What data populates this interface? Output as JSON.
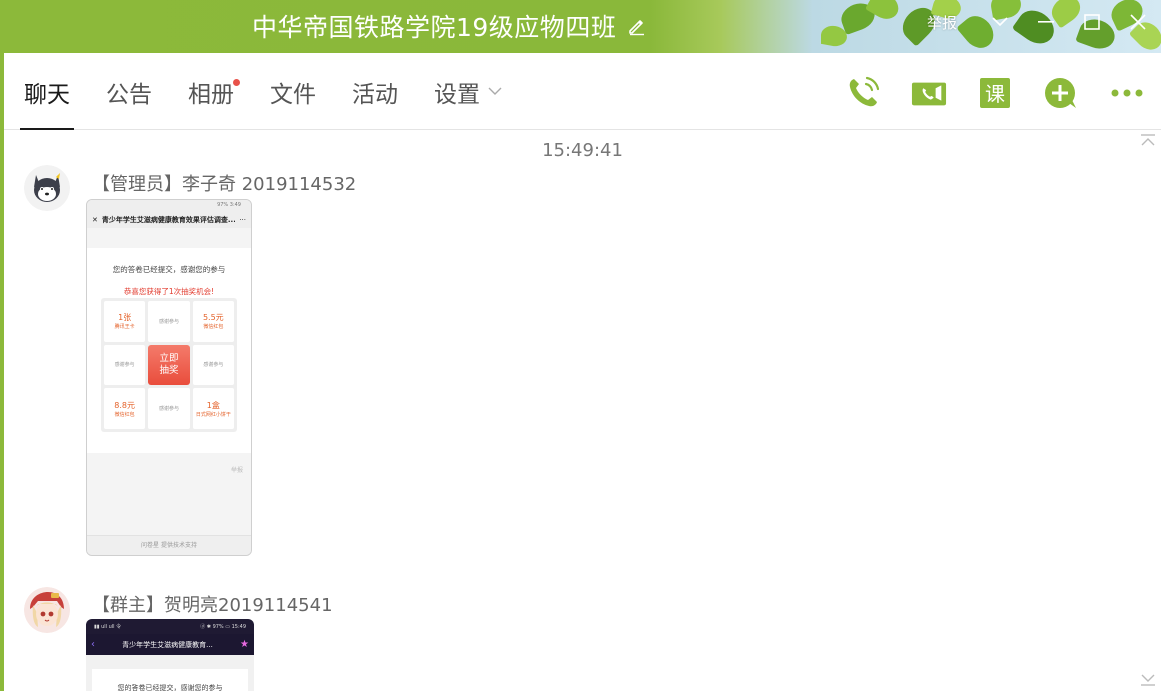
{
  "window": {
    "title": "中华帝国铁路学院19级应物四班",
    "report_label": "举报"
  },
  "tabs": [
    {
      "label": "聊天",
      "active": true
    },
    {
      "label": "公告",
      "active": false
    },
    {
      "label": "相册",
      "active": false,
      "badge": true
    },
    {
      "label": "文件",
      "active": false
    },
    {
      "label": "活动",
      "active": false
    },
    {
      "label": "设置",
      "active": false,
      "dropdown": true
    }
  ],
  "actions": {
    "course_label": "课",
    "icons": [
      "voice-call-icon",
      "video-call-icon",
      "course-icon",
      "add-icon",
      "more-icon"
    ]
  },
  "chat": {
    "timestamp": "15:49:41",
    "messages": [
      {
        "sender": "【管理员】李子奇 2019114532",
        "screenshot": {
          "status": "97% 3:49",
          "title": "青少年学生艾滋病健康教育效果评估调查...",
          "thanks": "您的答卷已经提交，感谢您的参与",
          "win_text": "恭喜您获得了1次抽奖机会!",
          "grid": [
            {
              "big": "1张",
              "sub": "腾讯王卡"
            },
            {
              "text": "感谢参与"
            },
            {
              "big": "5.5元",
              "sub": "微信红包"
            },
            {
              "text": "感谢参与"
            },
            {
              "center": "立即\n抽奖"
            },
            {
              "text": "感谢参与"
            },
            {
              "big": "8.8元",
              "sub": "微信红包"
            },
            {
              "text": "感谢参与"
            },
            {
              "big": "1盒",
              "sub": "日式网红小饼干"
            }
          ],
          "report": "举报",
          "footer": "问卷星 提供技术支持"
        }
      },
      {
        "sender": "【群主】贺明亮2019114541",
        "screenshot": {
          "status_left": "▮▮ ull ull 令",
          "status_right": "ⓓ ✱ 97% ▭ 15:49",
          "title": "青少年学生艾滋病健康教育...",
          "thanks": "您的答卷已经提交，感谢您的参与"
        }
      }
    ]
  },
  "colors": {
    "accent": "#8cb93a",
    "badge": "#e8524a"
  }
}
